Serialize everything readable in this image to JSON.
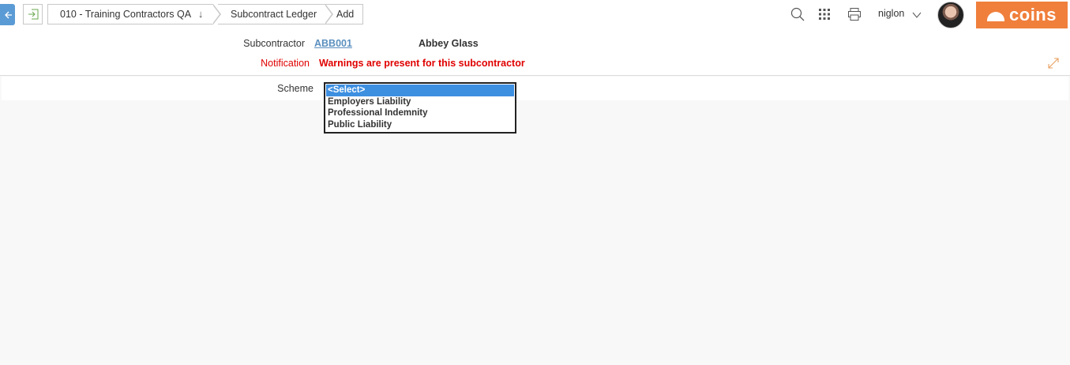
{
  "nav": {
    "breadcrumbs": [
      {
        "label": "010 - Training Contractors QA"
      },
      {
        "label": "Subcontract Ledger"
      },
      {
        "label": "Add"
      }
    ]
  },
  "user": {
    "name": "niglon"
  },
  "brand": {
    "logo_text": "coins",
    "color": "#f07f3c"
  },
  "header": {
    "subcontractor_label": "Subcontractor",
    "subcontractor_code": "ABB001",
    "subcontractor_name": "Abbey Glass",
    "notification_label": "Notification",
    "notification_message": "Warnings are present for this subcontractor"
  },
  "form": {
    "scheme_label": "Scheme",
    "scheme_options": [
      "<Select>",
      "Employers Liability",
      "Professional Indemnity",
      "Public Liability"
    ],
    "scheme_selected": "<Select>"
  },
  "colors": {
    "accent": "#5b9bd5",
    "warning": "#e00000",
    "selection": "#3d8fe0"
  }
}
